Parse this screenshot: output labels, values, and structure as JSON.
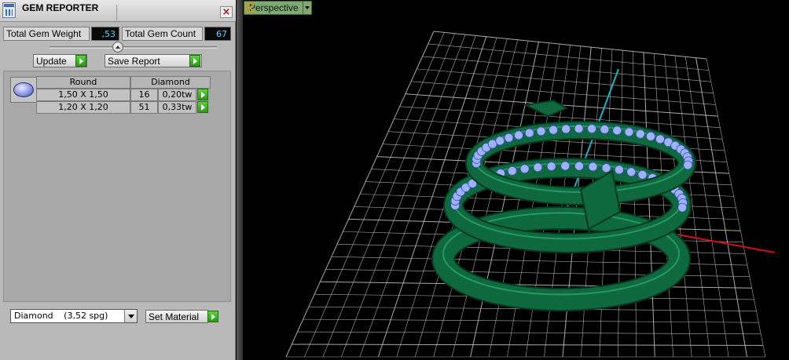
{
  "panel": {
    "title": "GEM REPORTER",
    "total_weight_label": "Total Gem Weight",
    "total_weight_value": ",53",
    "total_count_label": "Total Gem Count",
    "total_count_value": "67",
    "update_label": "Update",
    "save_report_label": "Save Report",
    "table": {
      "col_shape": "Round",
      "col_material": "Diamond",
      "rows": [
        {
          "size": "1,50 X 1,50",
          "count": "16",
          "weight": "0,20tw"
        },
        {
          "size": "1,20 X 1,20",
          "count": "51",
          "weight": "0,33tw"
        }
      ]
    },
    "material_selected": "Diamond",
    "material_density": "(3,52 spg)",
    "set_material_label": "Set Material"
  },
  "viewport": {
    "view_name": "Perspective",
    "colors": {
      "grid": "#c8c8c8",
      "axis_x": "#d01010",
      "axis_y": "#19b5c7",
      "metal": "#0e6a3e",
      "gem": "#9fb2ff"
    }
  },
  "icons": [
    "app-icon",
    "close-icon",
    "slider-knob",
    "gem-thumbnail",
    "dropdown-arrow-icon",
    "play-arrow-icon",
    "orientation-gizmo-icon"
  ]
}
